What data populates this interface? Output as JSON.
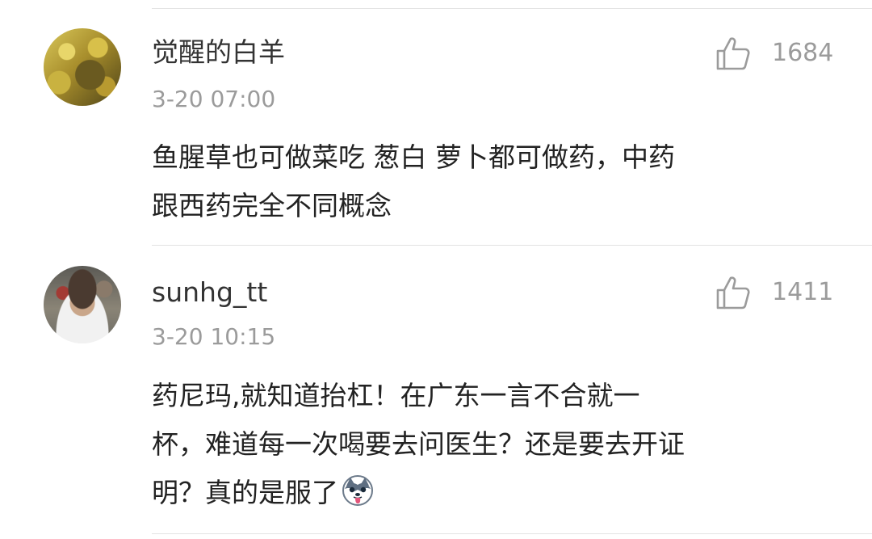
{
  "comments": [
    {
      "username": "觉醒的白羊",
      "timestamp": "3-20 07:00",
      "likes": "1684",
      "text_lines": [
        "鱼腥草也可做菜吃  葱白  萝卜都可做药，中药",
        "跟西药完全不同概念"
      ],
      "avatar_icon": "avatar-ginkgo-tree"
    },
    {
      "username": "sunhg_tt",
      "timestamp": "3-20 10:15",
      "likes": "1411",
      "text_lines": [
        "药尼玛,就知道抬杠！在广东一言不合就一",
        "杯，难道每一次喝要去问医生？还是要去开证",
        "明？真的是服了"
      ],
      "avatar_icon": "avatar-child-photo",
      "emoji_icon": "husky-tongue-emoji"
    }
  ],
  "like_icon": "thumbs-up-icon",
  "colors": {
    "username": "#333333",
    "meta": "#9b9b9b",
    "body": "#222222",
    "divider": "#e3e3e3"
  }
}
